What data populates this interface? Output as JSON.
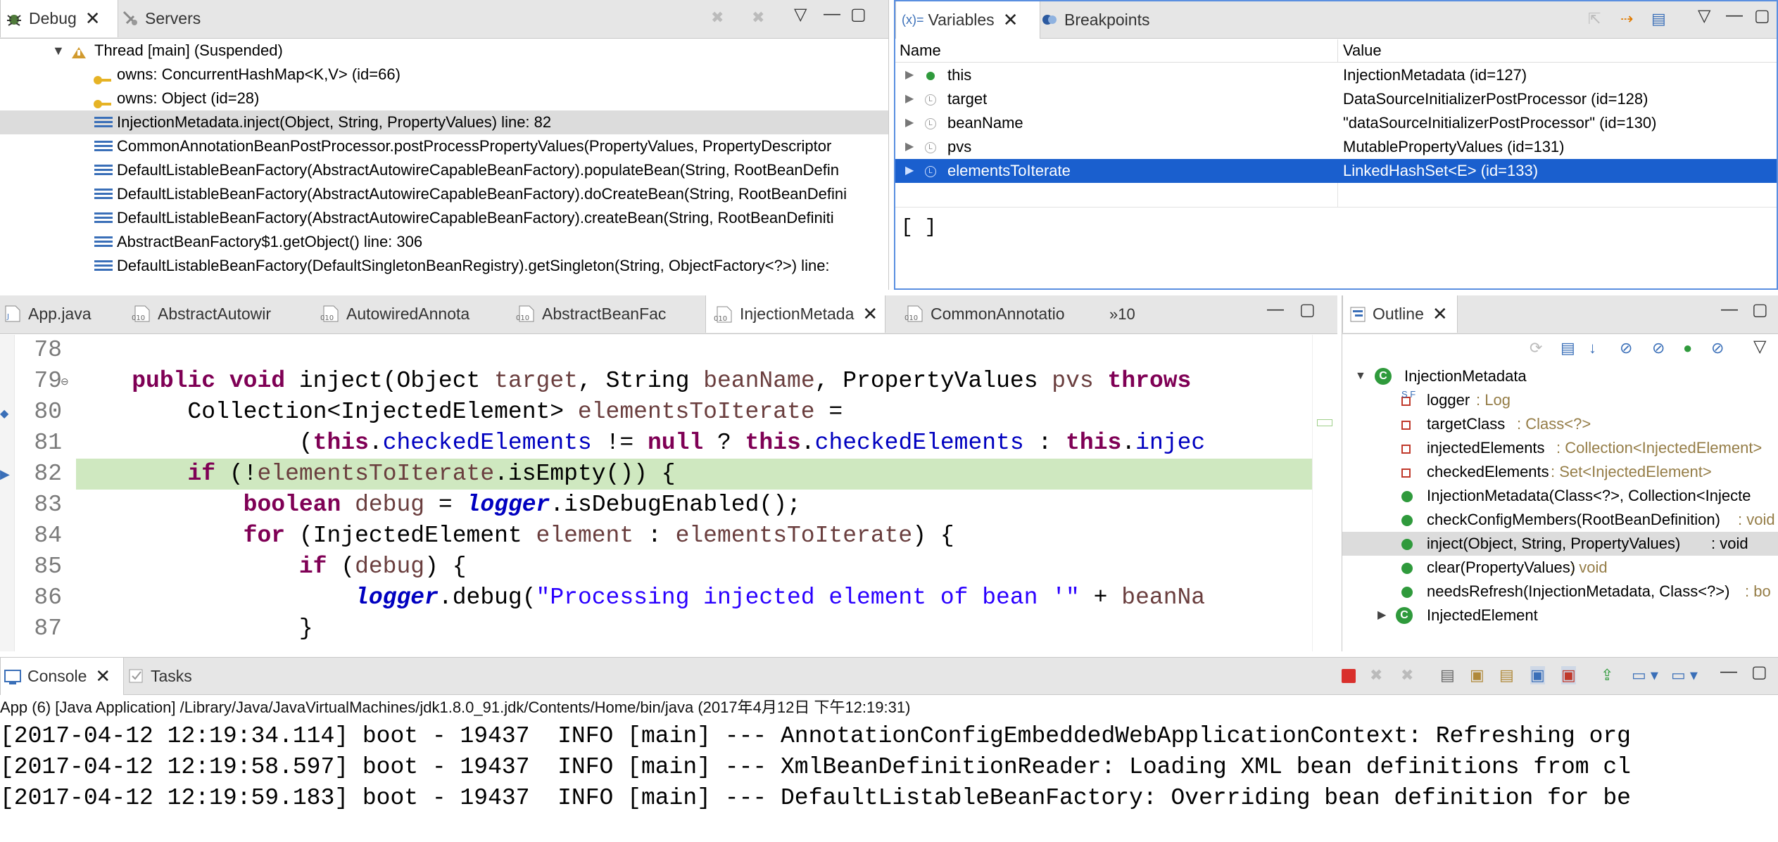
{
  "debug_view": {
    "tabs": [
      {
        "label": "Debug",
        "active": true
      },
      {
        "label": "Servers",
        "active": false
      }
    ],
    "thread_label": "Thread [main] (Suspended)",
    "monitors": [
      "owns: ConcurrentHashMap<K,V>  (id=66)",
      "owns: Object  (id=28)"
    ],
    "frames": [
      "InjectionMetadata.inject(Object, String, PropertyValues) line: 82",
      "CommonAnnotationBeanPostProcessor.postProcessPropertyValues(PropertyValues, PropertyDescriptor",
      "DefaultListableBeanFactory(AbstractAutowireCapableBeanFactory).populateBean(String, RootBeanDefin",
      "DefaultListableBeanFactory(AbstractAutowireCapableBeanFactory).doCreateBean(String, RootBeanDefini",
      "DefaultListableBeanFactory(AbstractAutowireCapableBeanFactory).createBean(String, RootBeanDefiniti",
      "AbstractBeanFactory$1.getObject() line: 306",
      "DefaultListableBeanFactory(DefaultSingletonBeanRegistry).getSingleton(String, ObjectFactory<?>) line:"
    ],
    "selected_frame_index": 0
  },
  "variables_view": {
    "tabs": [
      {
        "label": "Variables",
        "prefix": "(x)=",
        "active": true
      },
      {
        "label": "Breakpoints",
        "active": false
      }
    ],
    "columns": [
      "Name",
      "Value"
    ],
    "rows": [
      {
        "name": "this",
        "value": "InjectionMetadata  (id=127)",
        "icon": "green-dot"
      },
      {
        "name": "target",
        "value": "DataSourceInitializerPostProcessor  (id=128)",
        "icon": "local"
      },
      {
        "name": "beanName",
        "value": "\"dataSourceInitializerPostProcessor\" (id=130)",
        "icon": "local"
      },
      {
        "name": "pvs",
        "value": "MutablePropertyValues  (id=131)",
        "icon": "local"
      },
      {
        "name": "elementsToIterate",
        "value": "LinkedHashSet<E>  (id=133)",
        "icon": "local"
      }
    ],
    "selected_row_index": 4,
    "detail": "[ ]"
  },
  "editor": {
    "tabs": [
      {
        "label": "App.java",
        "active": false
      },
      {
        "label": "AbstractAutowir",
        "active": false
      },
      {
        "label": "AutowiredAnnota",
        "active": false
      },
      {
        "label": "AbstractBeanFac",
        "active": false
      },
      {
        "label": "InjectionMetada",
        "active": true
      },
      {
        "label": "CommonAnnotatio",
        "active": false
      }
    ],
    "overflow_label": "»10",
    "current_line": "82",
    "lines": [
      {
        "num": "78",
        "tokens": []
      },
      {
        "num": "79",
        "tokens": [
          [
            "",
            "    "
          ],
          [
            "kw",
            "public"
          ],
          [
            "",
            " "
          ],
          [
            "kw",
            "void"
          ],
          [
            "",
            " inject(Object "
          ],
          [
            "var",
            "target"
          ],
          [
            "",
            ", String "
          ],
          [
            "var",
            "beanName"
          ],
          [
            "",
            ", PropertyValues "
          ],
          [
            "var",
            "pvs"
          ],
          [
            "",
            " "
          ],
          [
            "kw",
            "throws"
          ]
        ]
      },
      {
        "num": "80",
        "tokens": [
          [
            "",
            "        Collection<InjectedElement> "
          ],
          [
            "var",
            "elementsToIterate"
          ],
          [
            "",
            " ="
          ]
        ]
      },
      {
        "num": "81",
        "tokens": [
          [
            "",
            "                ("
          ],
          [
            "kw",
            "this"
          ],
          [
            "",
            "."
          ],
          [
            "fld",
            "checkedElements"
          ],
          [
            "",
            " != "
          ],
          [
            "kw",
            "null"
          ],
          [
            "",
            " ? "
          ],
          [
            "kw",
            "this"
          ],
          [
            "",
            "."
          ],
          [
            "fld",
            "checkedElements"
          ],
          [
            "",
            " : "
          ],
          [
            "kw",
            "this"
          ],
          [
            "",
            "."
          ],
          [
            "fld",
            "injec"
          ]
        ]
      },
      {
        "num": "82",
        "tokens": [
          [
            "",
            "        "
          ],
          [
            "kw",
            "if"
          ],
          [
            "",
            " (!"
          ],
          [
            "var",
            "elementsToIterate"
          ],
          [
            "",
            ".isEmpty()) {"
          ]
        ]
      },
      {
        "num": "83",
        "tokens": [
          [
            "",
            "            "
          ],
          [
            "kw",
            "boolean"
          ],
          [
            "",
            " "
          ],
          [
            "var",
            "debug"
          ],
          [
            "",
            " = "
          ],
          [
            "stat",
            "logger"
          ],
          [
            "",
            ".isDebugEnabled();"
          ]
        ]
      },
      {
        "num": "84",
        "tokens": [
          [
            "",
            "            "
          ],
          [
            "kw",
            "for"
          ],
          [
            "",
            " (InjectedElement "
          ],
          [
            "var",
            "element"
          ],
          [
            "",
            " : "
          ],
          [
            "var",
            "elementsToIterate"
          ],
          [
            "",
            ") {"
          ]
        ]
      },
      {
        "num": "85",
        "tokens": [
          [
            "",
            "                "
          ],
          [
            "kw",
            "if"
          ],
          [
            "",
            " ("
          ],
          [
            "var",
            "debug"
          ],
          [
            "",
            ") {"
          ]
        ]
      },
      {
        "num": "86",
        "tokens": [
          [
            "",
            "                    "
          ],
          [
            "stat",
            "logger"
          ],
          [
            "",
            ".debug("
          ],
          [
            "str",
            "\"Processing injected element of bean '\""
          ],
          [
            "",
            " + "
          ],
          [
            "var",
            "beanNa"
          ]
        ]
      },
      {
        "num": "87",
        "tokens": [
          [
            "",
            "                }"
          ]
        ]
      }
    ]
  },
  "outline": {
    "tab_label": "Outline",
    "root": "InjectionMetadata",
    "members": [
      {
        "name": "logger",
        "type": " : Log",
        "icon": "static-final-field"
      },
      {
        "name": "targetClass",
        "type": " : Class<?>",
        "icon": "final-field"
      },
      {
        "name": "injectedElements",
        "type": " : Collection<InjectedElement>",
        "icon": "final-field"
      },
      {
        "name": "checkedElements",
        "type": " : Set<InjectedElement>",
        "icon": "volatile-field"
      },
      {
        "name": "InjectionMetadata(Class<?>, Collection<Injecte",
        "type": "",
        "icon": "constructor"
      },
      {
        "name": "checkConfigMembers(RootBeanDefinition)",
        "type": " : void",
        "icon": "method"
      },
      {
        "name": "inject(Object, String, PropertyValues)",
        "type": " : void",
        "icon": "method"
      },
      {
        "name": "clear(PropertyValues)",
        "type": " : void",
        "icon": "method"
      },
      {
        "name": "needsRefresh(InjectionMetadata, Class<?>)",
        "type": " : bo",
        "icon": "static-method"
      }
    ],
    "selected_member_index": 6,
    "nested_class": "InjectedElement"
  },
  "console": {
    "tabs": [
      {
        "label": "Console",
        "active": true
      },
      {
        "label": "Tasks",
        "active": false
      }
    ],
    "launch": "App (6) [Java Application] /Library/Java/JavaVirtualMachines/jdk1.8.0_91.jdk/Contents/Home/bin/java (2017年4月12日 下午12:19:31)",
    "lines": [
      "[2017-04-12 12:19:34.114] boot - 19437  INFO [main] --- AnnotationConfigEmbeddedWebApplicationContext: Refreshing org",
      "[2017-04-12 12:19:58.597] boot - 19437  INFO [main] --- XmlBeanDefinitionReader: Loading XML bean definitions from cl",
      "[2017-04-12 12:19:59.183] boot - 19437  INFO [main] --- DefaultListableBeanFactory: Overriding bean definition for be"
    ]
  },
  "colors": {
    "selection_blue": "#1a5fce",
    "current_line_green": "#cfe8c0",
    "keyword": "#7f0055",
    "field": "#0000c0",
    "string": "#2a00ff",
    "local_var": "#6a3e3e"
  }
}
